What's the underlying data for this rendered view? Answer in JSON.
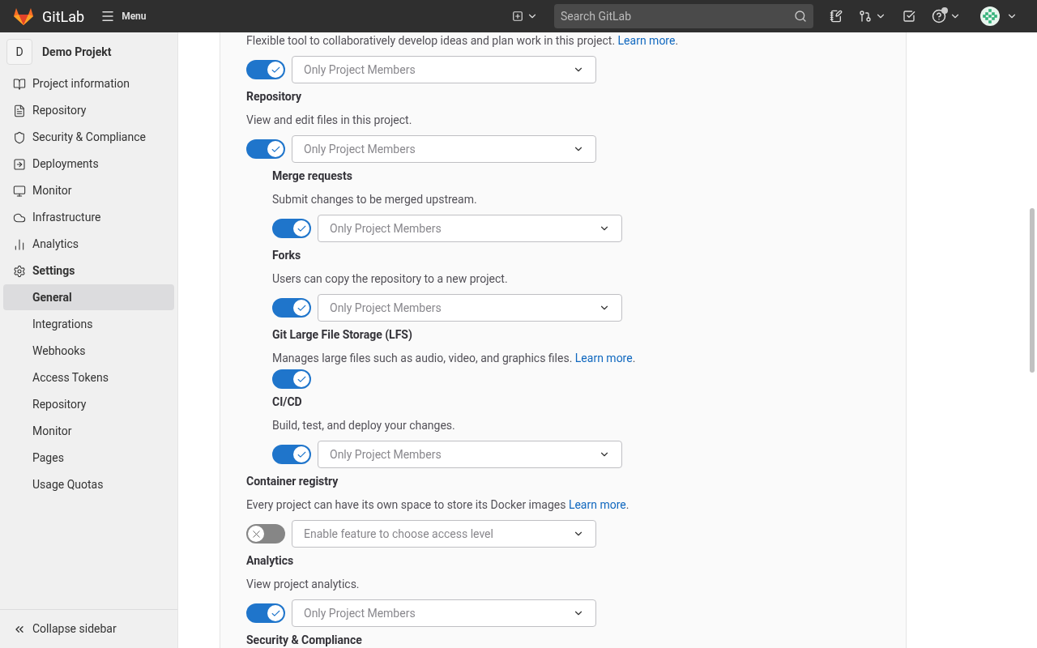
{
  "header": {
    "logo_text": "GitLab",
    "menu_label": "Menu",
    "search": {
      "placeholder": "Search GitLab"
    },
    "help_notification": true
  },
  "sidebar": {
    "project": {
      "avatar": "D",
      "name": "Demo Projekt"
    },
    "items": [
      {
        "label": "Project information",
        "selected": false
      },
      {
        "label": "Repository",
        "selected": false
      },
      {
        "label": "Security & Compliance",
        "selected": false
      },
      {
        "label": "Deployments",
        "selected": false
      },
      {
        "label": "Monitor",
        "selected": false
      },
      {
        "label": "Infrastructure",
        "selected": false
      },
      {
        "label": "Analytics",
        "selected": false
      },
      {
        "label": "Settings",
        "selected": true,
        "expanded": true,
        "children": [
          {
            "label": "General",
            "selected": true
          },
          {
            "label": "Integrations",
            "selected": false
          },
          {
            "label": "Webhooks",
            "selected": false
          },
          {
            "label": "Access Tokens",
            "selected": false
          },
          {
            "label": "Repository",
            "selected": false
          },
          {
            "label": "Monitor",
            "selected": false
          },
          {
            "label": "Pages",
            "selected": false
          },
          {
            "label": "Usage Quotas",
            "selected": false
          }
        ]
      }
    ],
    "collapse_label": "Collapse sidebar"
  },
  "features": [
    {
      "description": "Flexible tool to collaboratively develop ideas and plan work in this project.",
      "link": "Learn more",
      "after_link": ".",
      "on": true,
      "access": "Only Project Members"
    },
    {
      "name": "Repository",
      "description": "View and edit files in this project.",
      "on": true,
      "access": "Only Project Members",
      "children": [
        {
          "name": "Merge requests",
          "description": "Submit changes to be merged upstream.",
          "on": true,
          "access": "Only Project Members"
        },
        {
          "name": "Forks",
          "description": "Users can copy the repository to a new project.",
          "on": true,
          "access": "Only Project Members"
        },
        {
          "name": "Git Large File Storage (LFS)",
          "description": "Manages large files such as audio, video, and graphics files.",
          "link": "Learn more",
          "after_link": ".",
          "on": true
        },
        {
          "name": "CI/CD",
          "description": "Build, test, and deploy your changes.",
          "on": true,
          "access": "Only Project Members"
        }
      ]
    },
    {
      "name": "Container registry",
      "description": "Every project can have its own space to store its Docker images",
      "link": "Learn more",
      "after_link": ".",
      "on": false,
      "access": "Enable feature to choose access level"
    },
    {
      "name": "Analytics",
      "description": "View project analytics.",
      "on": true,
      "access": "Only Project Members"
    },
    {
      "name": "Security & Compliance"
    }
  ]
}
